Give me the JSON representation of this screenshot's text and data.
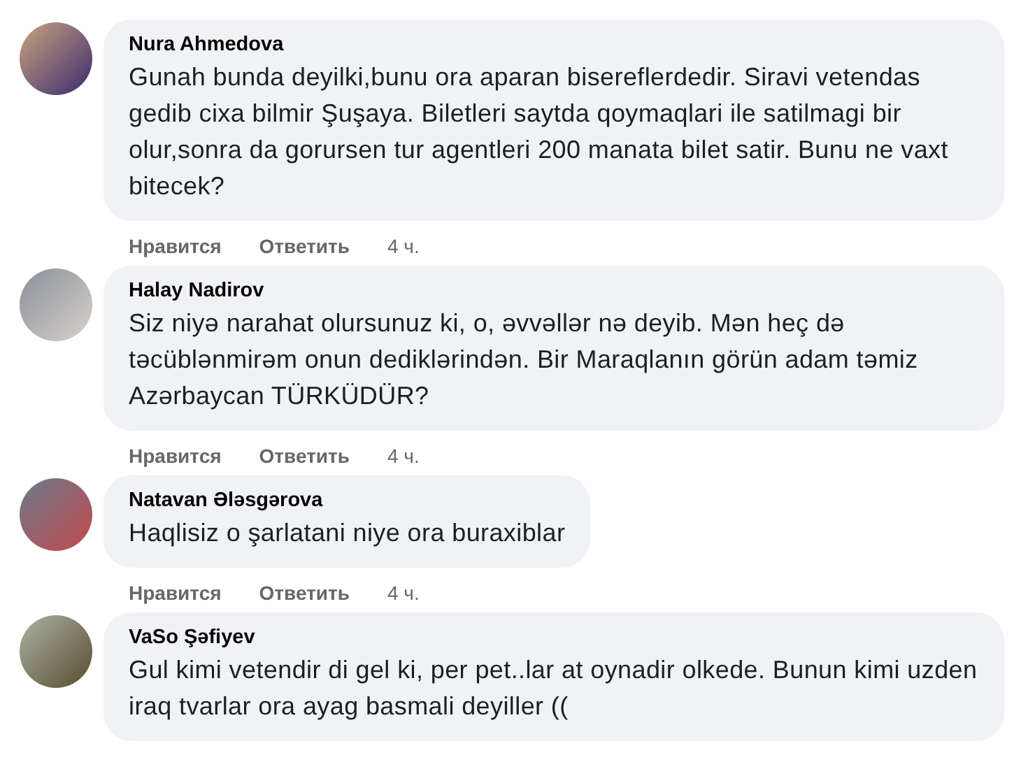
{
  "comments": [
    {
      "author": "Nura Ahmedova",
      "text": "Gunah bunda deyilki,bunu ora aparan bisereflerdedir. Siravi vetendas gedib cixa bilmir Şuşaya. Biletleri saytda qoymaqlari ile satilmagi bir olur,sonra da gorursen tur agentleri 200 manata bilet satir. Bunu ne vaxt bitecek?",
      "like": "Нравится",
      "reply": "Ответить",
      "time": "4 ч."
    },
    {
      "author": "Halay Nadirov",
      "text": "Siz niyə narahat olursunuz ki, o, əvvəllər nə deyib. Mən heç də təcüblənmirəm onun dediklərindən. Bir Maraqlanın görün adam təmiz Azərbaycan TÜRKÜDÜR?",
      "like": "Нравится",
      "reply": "Ответить",
      "time": "4 ч."
    },
    {
      "author": "Natavan Ələsgərova",
      "text": "Haqlisiz o şarlatani niye ora buraxiblar",
      "like": "Нравится",
      "reply": "Ответить",
      "time": "4 ч."
    },
    {
      "author": "VaSo Şəfiyev",
      "text": "Gul kimi vetendir di gel ki, per pet..lar at oynadir olkede. Bunun kimi uzden iraq tvarlar ora ayag basmali deyiller (("
    }
  ]
}
